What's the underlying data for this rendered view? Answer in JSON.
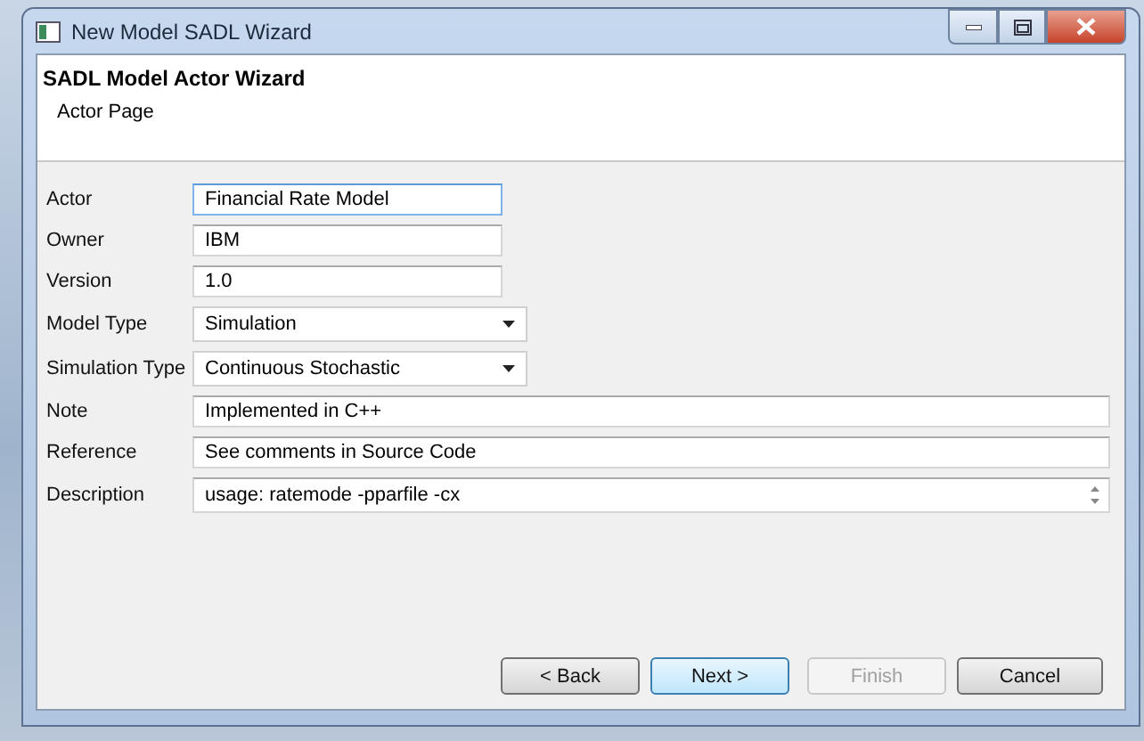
{
  "window": {
    "title": "New Model SADL Wizard"
  },
  "header": {
    "title": "SADL Model Actor Wizard",
    "subtitle": "Actor Page"
  },
  "fields": [
    {
      "kind": "short",
      "label": "Actor",
      "value": "Financial Rate Model",
      "focused": true
    },
    {
      "kind": "short",
      "label": "Owner",
      "value": "IBM",
      "focused": false
    },
    {
      "kind": "short",
      "label": "Version",
      "value": "1.0",
      "focused": false
    },
    {
      "kind": "select",
      "label": "Model Type",
      "value": "Simulation",
      "focused": false
    },
    {
      "kind": "select",
      "label": "Simulation Type",
      "value": "Continuous Stochastic",
      "focused": false
    },
    {
      "kind": "wide",
      "label": "Note",
      "value": "Implemented in C++",
      "focused": false
    },
    {
      "kind": "wide",
      "label": "Reference",
      "value": "See comments in Source Code",
      "focused": false
    },
    {
      "kind": "textarea",
      "label": "Description",
      "value": "usage: ratemode -pparfile -cx",
      "focused": false
    }
  ],
  "buttons": [
    {
      "label": "< Back",
      "disabled": false,
      "default": false
    },
    {
      "label": "Next >",
      "disabled": false,
      "default": true
    },
    {
      "label": "Finish",
      "disabled": true,
      "default": false
    },
    {
      "label": "Cancel",
      "disabled": false,
      "default": false
    }
  ]
}
